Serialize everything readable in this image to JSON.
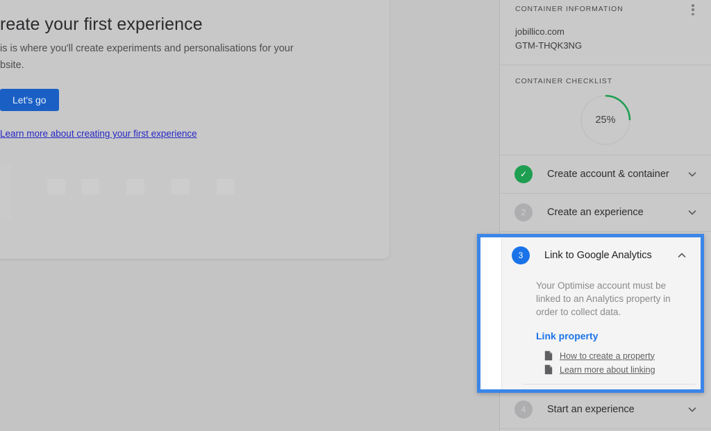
{
  "main": {
    "title": "reate your first experience",
    "subtitle": "is is where you'll create experiments and personalisations for your bsite.",
    "primary_button": "Let's go",
    "learn_link": "Learn more about creating your first experience"
  },
  "sidebar": {
    "container_information": {
      "label": "CONTAINER INFORMATION",
      "domain": "jobillico.com",
      "container_id": "GTM-THQK3NG",
      "menu_icon": "kebab-menu-icon"
    },
    "checklist": {
      "label": "CONTAINER CHECKLIST",
      "progress_percent": "25%",
      "progress_value": 25,
      "progress_color": "#1e9e51",
      "track_color": "#c0c0c0",
      "items": [
        {
          "badge": "✓",
          "state": "done",
          "title": "Create account & container",
          "chevron": "chevron-down-icon"
        },
        {
          "badge": "2",
          "state": "todo",
          "title": "Create an experience",
          "chevron": "chevron-down-icon"
        },
        {
          "badge": "4",
          "state": "todo",
          "title": "Start an experience",
          "chevron": "chevron-down-icon"
        }
      ]
    }
  },
  "highlighted_step": {
    "badge": "3",
    "title": "Link to Google Analytics",
    "chevron": "chevron-up-icon",
    "description": "Your Optimise account must be linked to an Analytics property in order to collect data.",
    "action_link": "Link property",
    "doc_links": [
      {
        "icon": "document-icon",
        "text": "How to create a property"
      },
      {
        "icon": "document-icon",
        "text": "Learn more about linking"
      }
    ],
    "accent_color": "#3b86e8"
  }
}
